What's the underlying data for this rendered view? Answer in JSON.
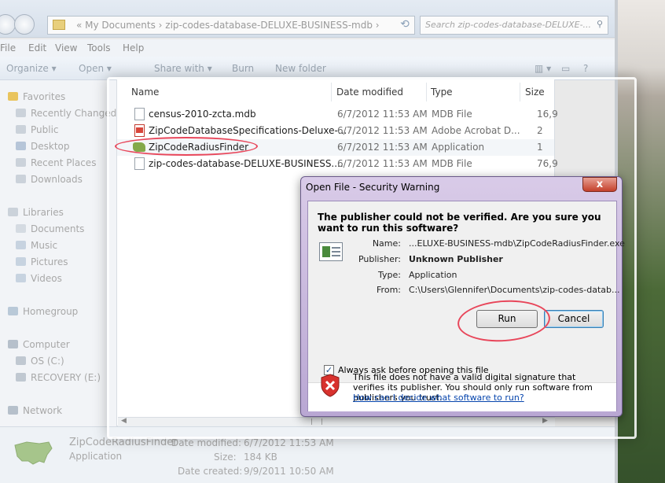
{
  "explorer": {
    "address": "« My Documents › zip-codes-database-DELUXE-BUSINESS-mdb ›",
    "search_placeholder": "Search zip-codes-database-DELUXE-...",
    "menu": [
      "File",
      "Edit",
      "View",
      "Tools",
      "Help"
    ],
    "toolbar": {
      "organize": "Organize ▾",
      "open": "Open ▾",
      "share": "Share with ▾",
      "burn": "Burn",
      "new_folder": "New folder"
    },
    "nav": {
      "favorites": "Favorites",
      "fav_items": [
        "Recently Changed",
        "Public",
        "Desktop",
        "Recent Places",
        "Downloads"
      ],
      "libraries": "Libraries",
      "lib_items": [
        "Documents",
        "Music",
        "Pictures",
        "Videos"
      ],
      "homegroup": "Homegroup",
      "computer": "Computer",
      "comp_items": [
        "OS (C:)",
        "RECOVERY (E:)"
      ],
      "network": "Network"
    },
    "columns": {
      "name": "Name",
      "date": "Date modified",
      "type": "Type",
      "size": "Size"
    },
    "files": [
      {
        "name": "census-2010-zcta.mdb",
        "date": "6/7/2012 11:53 AM",
        "type": "MDB File",
        "size": "16,9",
        "icon": "file-icon"
      },
      {
        "name": "ZipCodeDatabaseSpecifications-Deluxe-...",
        "date": "6/7/2012 11:53 AM",
        "type": "Adobe Acrobat D...",
        "size": "2",
        "icon": "pdf-icon"
      },
      {
        "name": "ZipCodeRadiusFinder",
        "date": "6/7/2012 11:53 AM",
        "type": "Application",
        "size": "1",
        "icon": "map-icon"
      },
      {
        "name": "zip-codes-database-DELUXE-BUSINESS....",
        "date": "6/7/2012 11:53 AM",
        "type": "MDB File",
        "size": "76,9",
        "icon": "file-icon"
      }
    ],
    "details": {
      "name": "ZipCodeRadiusFinder",
      "type": "Application",
      "modified_label": "Date modified:",
      "modified": "6/7/2012 11:53 AM",
      "size_label": "Size:",
      "size": "184 KB",
      "created_label": "Date created:",
      "created": "9/9/2011 10:50 AM"
    }
  },
  "dialog": {
    "title": "Open File - Security Warning",
    "close": "x",
    "heading": "The publisher could not be verified.  Are you sure you want to run this software?",
    "fields": [
      {
        "label": "Name:",
        "value": "...ELUXE-BUSINESS-mdb\\ZipCodeRadiusFinder.exe",
        "bold": false
      },
      {
        "label": "Publisher:",
        "value": "Unknown Publisher",
        "bold": true
      },
      {
        "label": "Type:",
        "value": "Application",
        "bold": false
      },
      {
        "label": "From:",
        "value": "C:\\Users\\Glennifer\\Documents\\zip-codes-datab...",
        "bold": false
      }
    ],
    "run": "Run",
    "cancel": "Cancel",
    "always_ask": "Always ask before opening this file",
    "always_ask_checked": true,
    "signature_text": "This file does not have a valid digital signature that verifies its publisher.  You should only run software from publishers you trust.",
    "help_link": "How can I decide what software to run?"
  },
  "colors": {
    "highlight_ring": "#e8465a",
    "dialog_frame": "#b9a7d3",
    "link": "#0645ad"
  }
}
